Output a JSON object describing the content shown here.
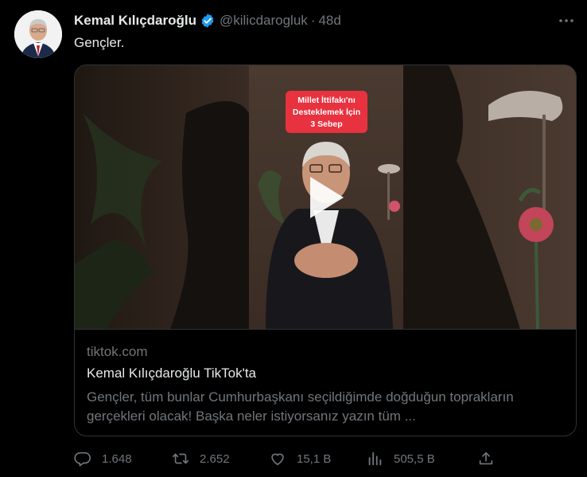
{
  "tweet": {
    "author_name": "Kemal Kılıçdaroğlu",
    "handle": "@kilicdarogluk",
    "separator": "·",
    "time": "48d",
    "text": "Gençler."
  },
  "card": {
    "overlay_text": [
      "Millet İttifakı'nı",
      "Desteklemek İçin",
      "3 Sebep"
    ],
    "domain": "tiktok.com",
    "title": "Kemal Kılıçdaroğlu TikTok'ta",
    "description": "Gençler, tüm bunlar Cumhurbaşkanı seçildiğimde doğduğun toprakların gerçekleri olacak! Başka neler istiyorsanız yazın tüm ..."
  },
  "actions": {
    "replies": "1.648",
    "retweets": "2.652",
    "likes": "15,1 B",
    "views": "505,5 B"
  },
  "colors": {
    "background": "#000000",
    "text": "#e7e9ea",
    "muted": "#71767b",
    "border": "#2f3336",
    "verified": "#1d9bf0",
    "overlay_red": "#e8323f"
  },
  "icons": [
    "verified-badge-icon",
    "more-icon",
    "play-icon",
    "reply-icon",
    "retweet-icon",
    "like-icon",
    "views-icon",
    "share-icon"
  ]
}
